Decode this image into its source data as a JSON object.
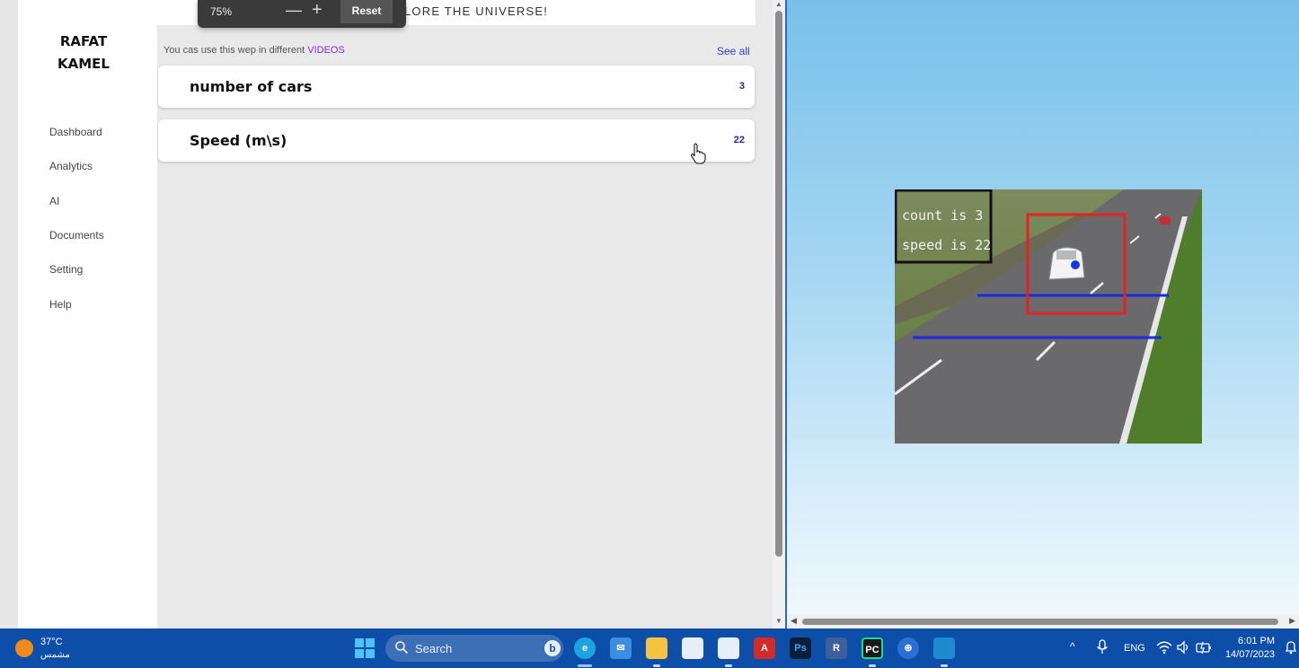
{
  "browser": {
    "zoom": {
      "level": "75%",
      "decrease": "—",
      "increase": "+",
      "reset_label": "Reset"
    },
    "scroll_up": "▲",
    "scroll_down": "▼"
  },
  "sidebar": {
    "brand_line1": "RAFAT",
    "brand_line2": "KAMEL",
    "items": [
      {
        "label": "Dashboard"
      },
      {
        "label": "Analytics"
      },
      {
        "label": "AI"
      },
      {
        "label": "Documents"
      },
      {
        "label": "Setting"
      },
      {
        "label": "Help"
      }
    ]
  },
  "header": {
    "hero_text": "LORE THE UNIVERSE!"
  },
  "main": {
    "hint_text": "You cas use this wep in different",
    "hint_link": "VIDEOS",
    "see_all": "See all",
    "cards": [
      {
        "title": "number of cars",
        "value": "3"
      },
      {
        "title": "Speed (m\\s)",
        "value": "22"
      }
    ]
  },
  "video": {
    "overlay_count": "count is 3",
    "overlay_speed": "speed is 22",
    "scroll_left": "◀",
    "scroll_right": "▶"
  },
  "taskbar": {
    "weather_temp": "37°C",
    "weather_desc": "مشمس",
    "search_label": "Search",
    "bing_label": "b",
    "apps": [
      {
        "name": "edge",
        "label": "e",
        "color": "#1fa3e0"
      },
      {
        "name": "mail",
        "label": "✉",
        "color": "#3b8ee0"
      },
      {
        "name": "file-explorer",
        "label": "",
        "color": "#f5c242"
      },
      {
        "name": "store",
        "label": "",
        "color": "#e8eef8"
      },
      {
        "name": "snipping-tool",
        "label": "",
        "color": "#e8eef8"
      },
      {
        "name": "acrobat",
        "label": "A",
        "color": "#d42a2a"
      },
      {
        "name": "photoshop",
        "label": "Ps",
        "color": "#0a1f3c"
      },
      {
        "name": "revit",
        "label": "R",
        "color": "#3d5f9c"
      },
      {
        "name": "pycharm",
        "label": "PC",
        "color": "#1a1a1a"
      },
      {
        "name": "vpn",
        "label": "⊕",
        "color": "#2a6fd6"
      },
      {
        "name": "vscode",
        "label": "",
        "color": "#1f8ad2"
      }
    ],
    "tray_chevron": "^",
    "language": "ENG",
    "clock_time": "6:01 PM",
    "clock_date": "14/07/2023"
  }
}
